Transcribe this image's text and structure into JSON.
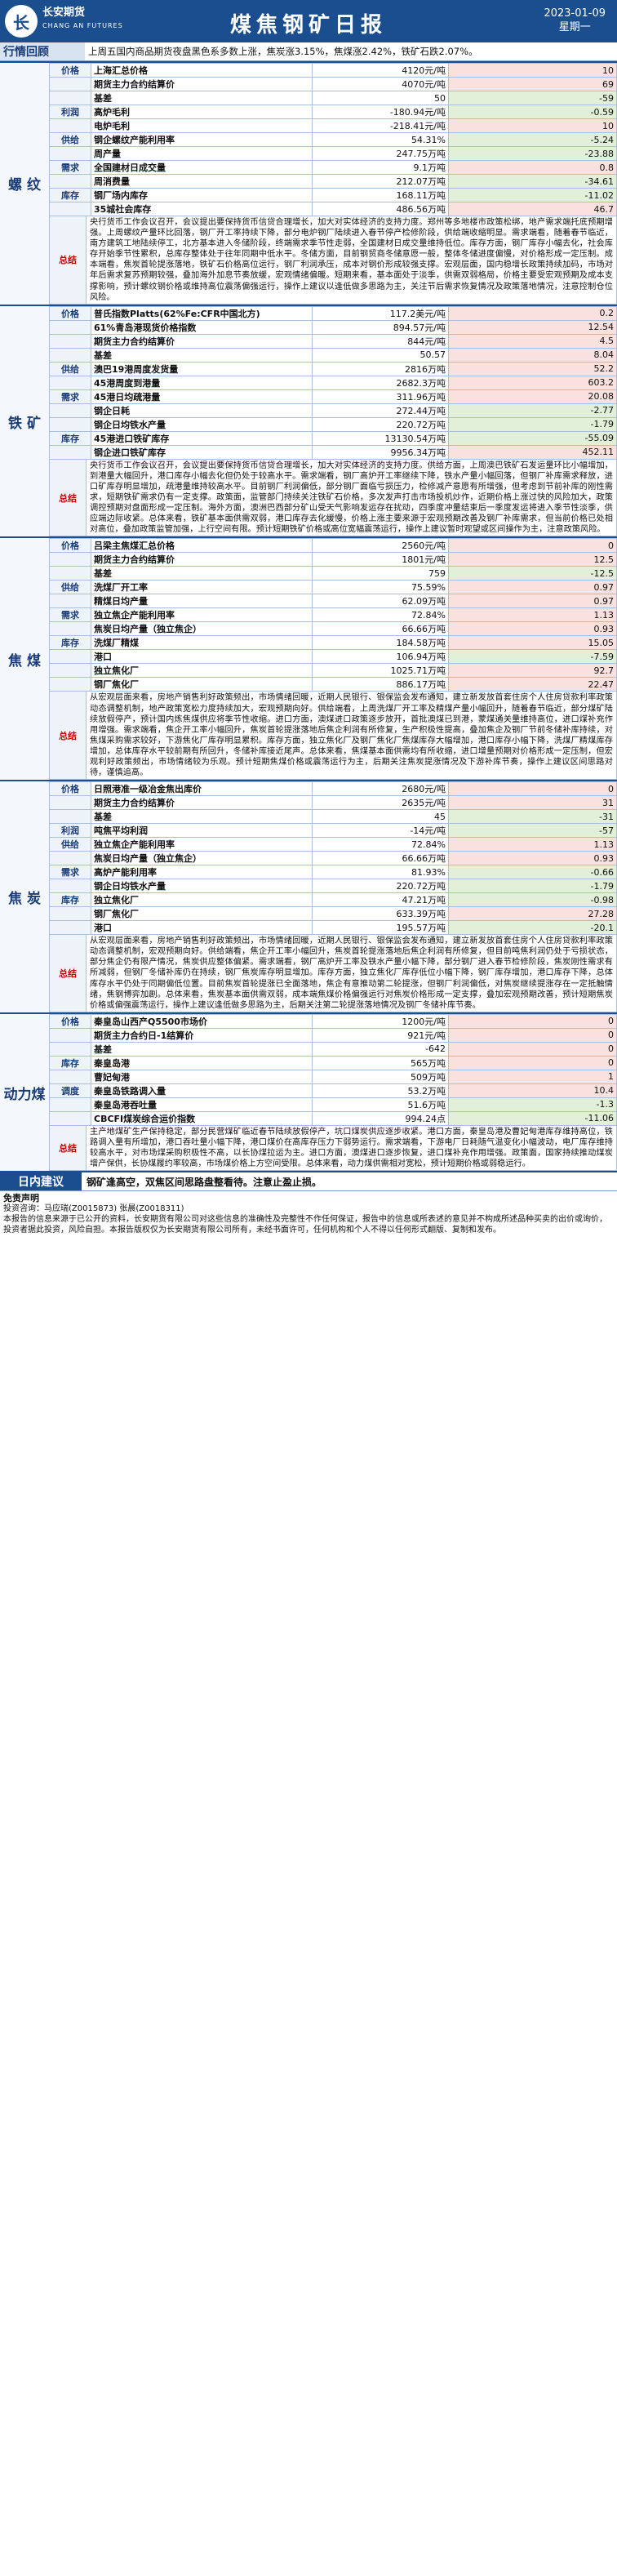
{
  "header": {
    "company_cn": "长安期货",
    "company_en": "CHANG AN FUTURES",
    "title": "煤焦钢矿日报",
    "date": "2023-01-09",
    "weekday": "星期一"
  },
  "market_review": {
    "label": "行情回顾",
    "text": "上周五国内商品期货夜盘黑色系多数上涨，焦炭涨3.15%，焦煤涨2.42%，铁矿石跌2.07%。"
  },
  "sections": [
    {
      "name": "螺 纹",
      "rows": [
        {
          "cat": "价格",
          "name": "上海汇总价格",
          "value": "4120元/吨",
          "change": "10",
          "dir": "pos"
        },
        {
          "cat": "",
          "name": "期货主力合约结算价",
          "value": "4070元/吨",
          "change": "69",
          "dir": "pos"
        },
        {
          "cat": "",
          "name": "基差",
          "value": "50",
          "change": "-59",
          "dir": "neg"
        },
        {
          "cat": "利润",
          "name": "高炉毛利",
          "value": "-180.94元/吨",
          "change": "-0.59",
          "dir": "neg"
        },
        {
          "cat": "",
          "name": "电炉毛利",
          "value": "-218.41元/吨",
          "change": "10",
          "dir": "pos"
        },
        {
          "cat": "供给",
          "name": "钢企螺纹产能利用率",
          "value": "54.31%",
          "change": "-5.24",
          "dir": "neg"
        },
        {
          "cat": "",
          "name": "周产量",
          "value": "247.75万吨",
          "change": "-23.88",
          "dir": "neg"
        },
        {
          "cat": "需求",
          "name": "全国建材日成交量",
          "value": "9.1万吨",
          "change": "0.8",
          "dir": "pos"
        },
        {
          "cat": "",
          "name": "周消费量",
          "value": "212.07万吨",
          "change": "-34.61",
          "dir": "neg"
        },
        {
          "cat": "库存",
          "name": "钢厂场内库存",
          "value": "168.11万吨",
          "change": "-11.02",
          "dir": "neg"
        },
        {
          "cat": "",
          "name": "35城社会库存",
          "value": "486.56万吨",
          "change": "46.7",
          "dir": "pos"
        }
      ],
      "summary_label": "总结",
      "summary": "央行货币工作会议召开，会议提出要保持货币信贷合理增长，加大对实体经济的支持力度。郑州等多地楼市政策松绑，地产需求端托底预期增强。上周螺纹产量环比回落，钢厂开工率持续下降，部分电炉钢厂陆续进入春节停产检修阶段，供给端收缩明显。需求端看，随着春节临近，南方建筑工地陆续停工，北方基本进入冬储阶段，终端需求季节性走弱，全国建材日成交量维持低位。库存方面，钢厂库存小幅去化，社会库存开始季节性累积，总库存整体处于往年同期中低水平。冬储方面，目前钢贸商冬储意愿一般，整体冬储进度偏慢，对价格形成一定压制。成本端看，焦炭首轮提涨落地，铁矿石价格高位运行，钢厂利润承压，成本对钢价形成较强支撑。宏观层面，国内稳增长政策持续加码，市场对年后需求复苏预期较强，叠加海外加息节奏放缓，宏观情绪偏暖。短期来看，基本面处于淡季，供需双弱格局，价格主要受宏观预期及成本支撑影响，预计螺纹钢价格或维持高位震荡偏强运行，操作上建议以逢低做多思路为主，关注节后需求恢复情况及政策落地情况，注意控制仓位风险。"
    },
    {
      "name": "铁 矿",
      "rows": [
        {
          "cat": "价格",
          "name": "普氏指数Platts(62%Fe:CFR中国北方)",
          "value": "117.2美元/吨",
          "change": "0.2",
          "dir": "pos"
        },
        {
          "cat": "",
          "name": "61%青岛港现货价格指数",
          "value": "894.57元/吨",
          "change": "12.54",
          "dir": "pos"
        },
        {
          "cat": "",
          "name": "期货主力合约结算价",
          "value": "844元/吨",
          "change": "4.5",
          "dir": "pos"
        },
        {
          "cat": "",
          "name": "基差",
          "value": "50.57",
          "change": "8.04",
          "dir": "pos"
        },
        {
          "cat": "供给",
          "name": "澳巴19港周度发货量",
          "value": "2816万吨",
          "change": "52.2",
          "dir": "pos"
        },
        {
          "cat": "",
          "name": "45港周度到港量",
          "value": "2682.3万吨",
          "change": "603.2",
          "dir": "pos"
        },
        {
          "cat": "需求",
          "name": "45港日均疏港量",
          "value": "311.96万吨",
          "change": "20.08",
          "dir": "pos"
        },
        {
          "cat": "",
          "name": "钢企日耗",
          "value": "272.44万吨",
          "change": "-2.77",
          "dir": "neg"
        },
        {
          "cat": "",
          "name": "钢企日均铁水产量",
          "value": "220.72万吨",
          "change": "-1.79",
          "dir": "neg"
        },
        {
          "cat": "库存",
          "name": "45港进口铁矿库存",
          "value": "13130.54万吨",
          "change": "-55.09",
          "dir": "neg"
        },
        {
          "cat": "",
          "name": "钢企进口铁矿库存",
          "value": "9956.34万吨",
          "change": "452.11",
          "dir": "pos"
        }
      ],
      "summary_label": "总结",
      "summary": "央行货币工作会议召开，会议提出要保持货币信贷合理增长，加大对实体经济的支持力度。供给方面，上周澳巴铁矿石发运量环比小幅增加，到港量大幅回升，港口库存小幅去化但仍处于较高水平。需求端看，钢厂高炉开工率继续下降，铁水产量小幅回落，但钢厂补库需求释放，进口矿库存明显增加，疏港量维持较高水平。目前钢厂利润偏低，部分钢厂面临亏损压力，检修减产意愿有所增强，但考虑到节前补库的刚性需求，短期铁矿需求仍有一定支撑。政策面，监管部门持续关注铁矿石价格，多次发声打击市场投机炒作，近期价格上涨过快的风险加大，政策调控预期对盘面形成一定压制。海外方面，澳洲巴西部分矿山受天气影响发运存在扰动，四季度冲量结束后一季度发运将进入季节性淡季，供应端边际收紧。总体来看，铁矿基本面供需双弱，港口库存去化缓慢，价格上涨主要来源于宏观预期改善及钢厂补库需求，但当前价格已处相对高位，叠加政策监管加强，上行空间有限。预计短期铁矿价格或高位宽幅震荡运行，操作上建议暂时观望或区间操作为主，注意政策风险。"
    },
    {
      "name": "焦 煤",
      "rows": [
        {
          "cat": "价格",
          "name": "吕梁主焦煤汇总价格",
          "value": "2560元/吨",
          "change": "0",
          "dir": "pos"
        },
        {
          "cat": "",
          "name": "期货主力合约结算价",
          "value": "1801元/吨",
          "change": "12.5",
          "dir": "pos"
        },
        {
          "cat": "",
          "name": "基差",
          "value": "759",
          "change": "-12.5",
          "dir": "neg"
        },
        {
          "cat": "供给",
          "name": "洗煤厂开工率",
          "value": "75.59%",
          "change": "0.97",
          "dir": "pos"
        },
        {
          "cat": "",
          "name": "精煤日均产量",
          "value": "62.09万吨",
          "change": "0.97",
          "dir": "pos"
        },
        {
          "cat": "需求",
          "name": "独立焦企产能利用率",
          "value": "72.84%",
          "change": "1.13",
          "dir": "pos"
        },
        {
          "cat": "",
          "name": "焦炭日均产量（独立焦企）",
          "value": "66.66万吨",
          "change": "0.93",
          "dir": "pos"
        },
        {
          "cat": "库存",
          "name": "洗煤厂精煤",
          "value": "184.58万吨",
          "change": "15.05",
          "dir": "pos"
        },
        {
          "cat": "",
          "name": "港口",
          "value": "106.94万吨",
          "change": "-7.59",
          "dir": "neg"
        },
        {
          "cat": "",
          "name": "独立焦化厂",
          "value": "1025.71万吨",
          "change": "92.7",
          "dir": "pos"
        },
        {
          "cat": "",
          "name": "钢厂焦化厂",
          "value": "886.17万吨",
          "change": "22.47",
          "dir": "pos"
        }
      ],
      "summary_label": "总结",
      "summary": "从宏观层面来看，房地产销售利好政策频出，市场情绪回暖，近期人民银行、银保监会发布通知，建立新发放首套住房个人住房贷款利率政策动态调整机制，地产政策宽松力度持续加大，宏观预期向好。供给端看，上周洗煤厂开工率及精煤产量小幅回升，随着春节临近，部分煤矿陆续放假停产，预计国内炼焦煤供应将季节性收缩。进口方面，澳煤进口政策逐步放开，首批澳煤已到港，蒙煤通关量维持高位，进口煤补充作用增强。需求端看，焦企开工率小幅回升，焦炭首轮提涨落地后焦企利润有所修复，生产积极性提高，叠加焦企及钢厂节前冬储补库持续，对焦煤采购需求较好，下游焦化厂库存明显累积。库存方面，独立焦化厂及钢厂焦化厂焦煤库存大幅增加，港口库存小幅下降，洗煤厂精煤库存增加，总体库存水平较前期有所回升，冬储补库接近尾声。总体来看，焦煤基本面供需均有所收缩，进口增量预期对价格形成一定压制，但宏观利好政策频出，市场情绪较为乐观。预计短期焦煤价格或震荡运行为主，后期关注焦炭提涨情况及下游补库节奏，操作上建议区间思路对待，谨慎追高。"
    },
    {
      "name": "焦 炭",
      "rows": [
        {
          "cat": "价格",
          "name": "日照港准一级冶金焦出库价",
          "value": "2680元/吨",
          "change": "0",
          "dir": "pos"
        },
        {
          "cat": "",
          "name": "期货主力合约结算价",
          "value": "2635元/吨",
          "change": "31",
          "dir": "pos"
        },
        {
          "cat": "",
          "name": "基差",
          "value": "45",
          "change": "-31",
          "dir": "neg"
        },
        {
          "cat": "利润",
          "name": "吨焦平均利润",
          "value": "-14元/吨",
          "change": "-57",
          "dir": "neg"
        },
        {
          "cat": "供给",
          "name": "独立焦企产能利用率",
          "value": "72.84%",
          "change": "1.13",
          "dir": "pos"
        },
        {
          "cat": "",
          "name": "焦炭日均产量（独立焦企）",
          "value": "66.66万吨",
          "change": "0.93",
          "dir": "pos"
        },
        {
          "cat": "需求",
          "name": "高炉产能利用率",
          "value": "81.93%",
          "change": "-0.66",
          "dir": "neg"
        },
        {
          "cat": "",
          "name": "钢企日均铁水产量",
          "value": "220.72万吨",
          "change": "-1.79",
          "dir": "neg"
        },
        {
          "cat": "库存",
          "name": "独立焦化厂",
          "value": "47.21万吨",
          "change": "-0.98",
          "dir": "neg"
        },
        {
          "cat": "",
          "name": "钢厂焦化厂",
          "value": "633.39万吨",
          "change": "27.28",
          "dir": "pos"
        },
        {
          "cat": "",
          "name": "港口",
          "value": "195.57万吨",
          "change": "-20.1",
          "dir": "neg"
        }
      ],
      "summary_label": "总结",
      "summary": "从宏观层面来看，房地产销售利好政策频出，市场情绪回暖，近期人民银行、银保监会发布通知，建立新发放首套住房个人住房贷款利率政策动态调整机制，宏观预期向好。供给端看，焦企开工率小幅回升，焦炭首轮提涨落地后焦企利润有所修复，但目前吨焦利润仍处于亏损状态，部分焦企仍有限产情况，焦炭供应整体偏紧。需求端看，钢厂高炉开工率及铁水产量小幅下降，部分钢厂进入春节检修阶段，焦炭刚性需求有所减弱，但钢厂冬储补库仍在持续，钢厂焦炭库存明显增加。库存方面，独立焦化厂库存低位小幅下降，钢厂库存增加，港口库存下降，总体库存水平仍处于同期偏低位置。目前焦炭首轮提涨已全面落地，焦企有意推动第二轮提涨，但钢厂利润偏低，对焦炭继续提涨存在一定抵触情绪，焦钢博弈加剧。总体来看，焦炭基本面供需双弱，成本端焦煤价格偏强运行对焦炭价格形成一定支撑，叠加宏观预期改善，预计短期焦炭价格或偏强震荡运行，操作上建议逢低做多思路为主，后期关注第二轮提涨落地情况及钢厂冬储补库节奏。"
    },
    {
      "name": "动力煤",
      "rows": [
        {
          "cat": "价格",
          "name": "秦皇岛山西产Q5500市场价",
          "value": "1200元/吨",
          "change": "0",
          "dir": "pos"
        },
        {
          "cat": "",
          "name": "期货主力合约日-1结算价",
          "value": "921元/吨",
          "change": "0",
          "dir": "pos"
        },
        {
          "cat": "",
          "name": "基差",
          "value": "-642",
          "change": "0",
          "dir": "pos"
        },
        {
          "cat": "库存",
          "name": "秦皇岛港",
          "value": "565万吨",
          "change": "0",
          "dir": "pos"
        },
        {
          "cat": "",
          "name": "曹妃甸港",
          "value": "509万吨",
          "change": "1",
          "dir": "pos"
        },
        {
          "cat": "调度",
          "name": "秦皇岛铁路调入量",
          "value": "53.2万吨",
          "change": "10.4",
          "dir": "pos"
        },
        {
          "cat": "",
          "name": "秦皇岛港吞吐量",
          "value": "51.6万吨",
          "change": "-1.3",
          "dir": "neg"
        },
        {
          "cat": "",
          "name": "CBCFI煤炭综合运价指数",
          "value": "994.24点",
          "change": "-11.06",
          "dir": "neg"
        }
      ],
      "summary_label": "总结",
      "summary": "主产地煤矿生产保持稳定，部分民营煤矿临近春节陆续放假停产，坑口煤炭供应逐步收紧。港口方面，秦皇岛港及曹妃甸港库存维持高位，铁路调入量有所增加，港口吞吐量小幅下降，港口煤价在高库存压力下弱势运行。需求端看，下游电厂日耗随气温变化小幅波动，电厂库存维持较高水平，对市场煤采购积极性不高，以长协煤拉运为主。进口方面，澳煤进口逐步恢复，进口煤补充作用增强。政策面，国家持续推动煤炭增产保供，长协煤履约率较高，市场煤价格上方空间受限。总体来看，动力煤供需相对宽松，预计短期价格或弱稳运行。"
    }
  ],
  "advice": {
    "label": "日内建议",
    "text": "钢矿逢高空，双焦区间思路盘整看待。注意止盈止损。"
  },
  "disclaimer": {
    "title": "免责声明",
    "analysts": "投资咨询：马应瑞(Z0015873) 张晨(Z0018311)",
    "body": "本报告的信息来源于已公开的资料，长安期货有限公司对这些信息的准确性及完整性不作任何保证，报告中的信息或所表述的意见并不构成所述品种买卖的出价或询价，投资者据此投资，风险自担。本报告版权仅为长安期货有限公司所有，未经书面许可，任何机构和个人不得以任何形式翻版、复制和发布。"
  }
}
